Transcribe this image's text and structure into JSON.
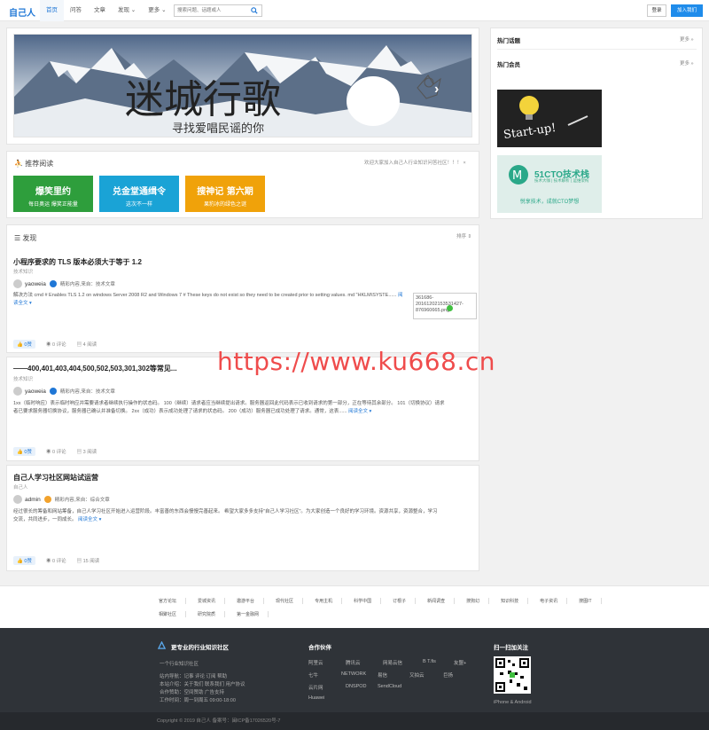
{
  "header": {
    "logo": "自己人",
    "nav": [
      {
        "label": "首页"
      },
      {
        "label": "问答"
      },
      {
        "label": "文章"
      },
      {
        "label": "发现 ⌄"
      },
      {
        "label": "更多 ⌄"
      }
    ],
    "search_placeholder": "搜索问题、话题或人",
    "login": "登录",
    "join": "加入我们"
  },
  "banner": {
    "title": "迷城行歌",
    "subtitle": "寻找爱唱民谣的你",
    "arrow": "›"
  },
  "recommend": {
    "title": "推荐阅读",
    "welcome": "欢迎大家加入自己人行业知识问答社区！！！ ×",
    "tiles": [
      {
        "big": "爆笑里约",
        "small": "每日奥运  爆笑正能量",
        "color": "#2e9e3c"
      },
      {
        "big": "兑金堂通缉令",
        "small": "这次不一样",
        "color": "#1aa3d6"
      },
      {
        "big": "搜神记  第六期",
        "small": "果豹冰的绿色之谜",
        "color": "#f0a20a"
      }
    ]
  },
  "discover": {
    "title": "发现",
    "sort": "排序 ⇕"
  },
  "articles": [
    {
      "title": "小程序要求的 TLS 版本必须大于等于 1.2",
      "tag": "技术知识",
      "author": "yaoweia",
      "meta": "精彩内容,来自：技术文章",
      "excerpt": "解决方法   cmd   # Enables TLS 1.2 on windows Server 2008 R2 and Windows 7 # These keys do not exist so they need to be created prior to setting values. md \"HKLM\\SYSTE......",
      "readmore": "阅读全文 ▾",
      "likes": "0赞",
      "comments": "0 评论",
      "views": "4 阅读",
      "thumb": "361686-20161202153531427-876960665.png"
    },
    {
      "title": "——400,401,403,404,500,502,503,301,302等常见...",
      "tag": "技术知识",
      "author": "yaoweia",
      "meta": "精彩内容,来自：技术文章",
      "excerpt_line1": "1xx（临时响应）表示临时响应并需要请求者继续执行操作的状态码。 100（继续）请求者应当继续提出请求。服务器返回此代码表示已收到请求的第一部分，正在等待其余部分。 101（切换协议）请求",
      "excerpt_line2": "者已要求服务器切换协议，服务器已确认并准备切换。 2xx（成功）表示成功处理了请求的状态码。 200（成功）服务器已成功处理了请求。通常，这表......",
      "readmore": "阅读全文 ▾",
      "likes": "0赞",
      "comments": "0 评论",
      "views": "3 阅读"
    },
    {
      "title": "自己人学习社区网站试运营",
      "tag": "自己人",
      "author": "admin",
      "meta": "精彩内容,来自：综合文章",
      "excerpt_line1": "经过很长的筹备和网站筹备，自己人学习社区开始进入运营阶段。丰富善的东西会慢慢完善起来。 希望大家多多支持\"自己人学习社区\"。为大家创造一个良好的学习环境。资源共享，资源整合，学习",
      "excerpt_line2": "交流，共同进步，一同成长。",
      "readmore": "阅读全文 ▾",
      "likes": "0赞",
      "comments": "0 评论",
      "views": "15 阅读"
    }
  ],
  "sidebar": {
    "hot_topics": "热门话题",
    "hot_members": "热门会员",
    "more": "更多 »",
    "ad1_text": "Start-up!",
    "ad2_brand": "51CTO技术栈",
    "ad2_sub": "技术大咖 | 技术解析 | 运维架构",
    "ad2_slogan": "悦享技术，成就CTO梦想"
  },
  "watermark": "https://www.ku668.cn",
  "links": {
    "row1": [
      "官方论坛",
      "爱城资讯",
      "邀游平台",
      "现代社区",
      "专用主机",
      "科学中国",
      "订根子",
      "新闻调查",
      "搜狗幻",
      "知识科技",
      "电子资讯",
      "搜图IT"
    ],
    "row2": [
      "相聚社区",
      "研究院质",
      "第一金融网"
    ]
  },
  "footer": {
    "about_title": "更专业的行业知识社区",
    "about_sub": "一个行业知识社区",
    "about_lines": [
      "站内导航：记事 评论 订阅 帮助",
      "本站介绍：关于我们 联系我们 用户协议",
      "合作赞助：空间赞助 广告支持",
      "工作时间：周一到周五 09:00-18:00"
    ],
    "partners_title": "合作伙伴",
    "partners": [
      "阿里云",
      "腾讯云",
      "网易云信",
      "B T.fis",
      "友盟+",
      "七牛",
      "NETWORK",
      "DNSPOD",
      "云片网",
      "SendCloud",
      "又拍云",
      "易信",
      "巨扬",
      "Huawei"
    ],
    "qr_title": "扫一扫加关注",
    "qr_caption": "iPhone & Android",
    "copyright": "Copyright © 2019 自己人 备案号：闽ICP备17026520号-7"
  }
}
